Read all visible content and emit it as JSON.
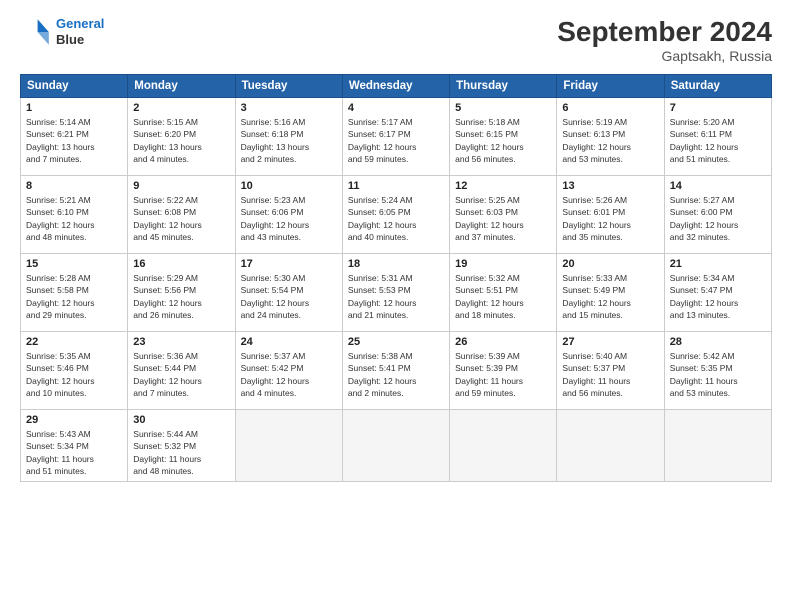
{
  "header": {
    "logo_line1": "General",
    "logo_line2": "Blue",
    "month_title": "September 2024",
    "location": "Gaptsakh, Russia"
  },
  "columns": [
    "Sunday",
    "Monday",
    "Tuesday",
    "Wednesday",
    "Thursday",
    "Friday",
    "Saturday"
  ],
  "weeks": [
    [
      {
        "day": "1",
        "info": "Sunrise: 5:14 AM\nSunset: 6:21 PM\nDaylight: 13 hours\nand 7 minutes."
      },
      {
        "day": "2",
        "info": "Sunrise: 5:15 AM\nSunset: 6:20 PM\nDaylight: 13 hours\nand 4 minutes."
      },
      {
        "day": "3",
        "info": "Sunrise: 5:16 AM\nSunset: 6:18 PM\nDaylight: 13 hours\nand 2 minutes."
      },
      {
        "day": "4",
        "info": "Sunrise: 5:17 AM\nSunset: 6:17 PM\nDaylight: 12 hours\nand 59 minutes."
      },
      {
        "day": "5",
        "info": "Sunrise: 5:18 AM\nSunset: 6:15 PM\nDaylight: 12 hours\nand 56 minutes."
      },
      {
        "day": "6",
        "info": "Sunrise: 5:19 AM\nSunset: 6:13 PM\nDaylight: 12 hours\nand 53 minutes."
      },
      {
        "day": "7",
        "info": "Sunrise: 5:20 AM\nSunset: 6:11 PM\nDaylight: 12 hours\nand 51 minutes."
      }
    ],
    [
      {
        "day": "8",
        "info": "Sunrise: 5:21 AM\nSunset: 6:10 PM\nDaylight: 12 hours\nand 48 minutes."
      },
      {
        "day": "9",
        "info": "Sunrise: 5:22 AM\nSunset: 6:08 PM\nDaylight: 12 hours\nand 45 minutes."
      },
      {
        "day": "10",
        "info": "Sunrise: 5:23 AM\nSunset: 6:06 PM\nDaylight: 12 hours\nand 43 minutes."
      },
      {
        "day": "11",
        "info": "Sunrise: 5:24 AM\nSunset: 6:05 PM\nDaylight: 12 hours\nand 40 minutes."
      },
      {
        "day": "12",
        "info": "Sunrise: 5:25 AM\nSunset: 6:03 PM\nDaylight: 12 hours\nand 37 minutes."
      },
      {
        "day": "13",
        "info": "Sunrise: 5:26 AM\nSunset: 6:01 PM\nDaylight: 12 hours\nand 35 minutes."
      },
      {
        "day": "14",
        "info": "Sunrise: 5:27 AM\nSunset: 6:00 PM\nDaylight: 12 hours\nand 32 minutes."
      }
    ],
    [
      {
        "day": "15",
        "info": "Sunrise: 5:28 AM\nSunset: 5:58 PM\nDaylight: 12 hours\nand 29 minutes."
      },
      {
        "day": "16",
        "info": "Sunrise: 5:29 AM\nSunset: 5:56 PM\nDaylight: 12 hours\nand 26 minutes."
      },
      {
        "day": "17",
        "info": "Sunrise: 5:30 AM\nSunset: 5:54 PM\nDaylight: 12 hours\nand 24 minutes."
      },
      {
        "day": "18",
        "info": "Sunrise: 5:31 AM\nSunset: 5:53 PM\nDaylight: 12 hours\nand 21 minutes."
      },
      {
        "day": "19",
        "info": "Sunrise: 5:32 AM\nSunset: 5:51 PM\nDaylight: 12 hours\nand 18 minutes."
      },
      {
        "day": "20",
        "info": "Sunrise: 5:33 AM\nSunset: 5:49 PM\nDaylight: 12 hours\nand 15 minutes."
      },
      {
        "day": "21",
        "info": "Sunrise: 5:34 AM\nSunset: 5:47 PM\nDaylight: 12 hours\nand 13 minutes."
      }
    ],
    [
      {
        "day": "22",
        "info": "Sunrise: 5:35 AM\nSunset: 5:46 PM\nDaylight: 12 hours\nand 10 minutes."
      },
      {
        "day": "23",
        "info": "Sunrise: 5:36 AM\nSunset: 5:44 PM\nDaylight: 12 hours\nand 7 minutes."
      },
      {
        "day": "24",
        "info": "Sunrise: 5:37 AM\nSunset: 5:42 PM\nDaylight: 12 hours\nand 4 minutes."
      },
      {
        "day": "25",
        "info": "Sunrise: 5:38 AM\nSunset: 5:41 PM\nDaylight: 12 hours\nand 2 minutes."
      },
      {
        "day": "26",
        "info": "Sunrise: 5:39 AM\nSunset: 5:39 PM\nDaylight: 11 hours\nand 59 minutes."
      },
      {
        "day": "27",
        "info": "Sunrise: 5:40 AM\nSunset: 5:37 PM\nDaylight: 11 hours\nand 56 minutes."
      },
      {
        "day": "28",
        "info": "Sunrise: 5:42 AM\nSunset: 5:35 PM\nDaylight: 11 hours\nand 53 minutes."
      }
    ],
    [
      {
        "day": "29",
        "info": "Sunrise: 5:43 AM\nSunset: 5:34 PM\nDaylight: 11 hours\nand 51 minutes."
      },
      {
        "day": "30",
        "info": "Sunrise: 5:44 AM\nSunset: 5:32 PM\nDaylight: 11 hours\nand 48 minutes."
      },
      null,
      null,
      null,
      null,
      null
    ]
  ]
}
